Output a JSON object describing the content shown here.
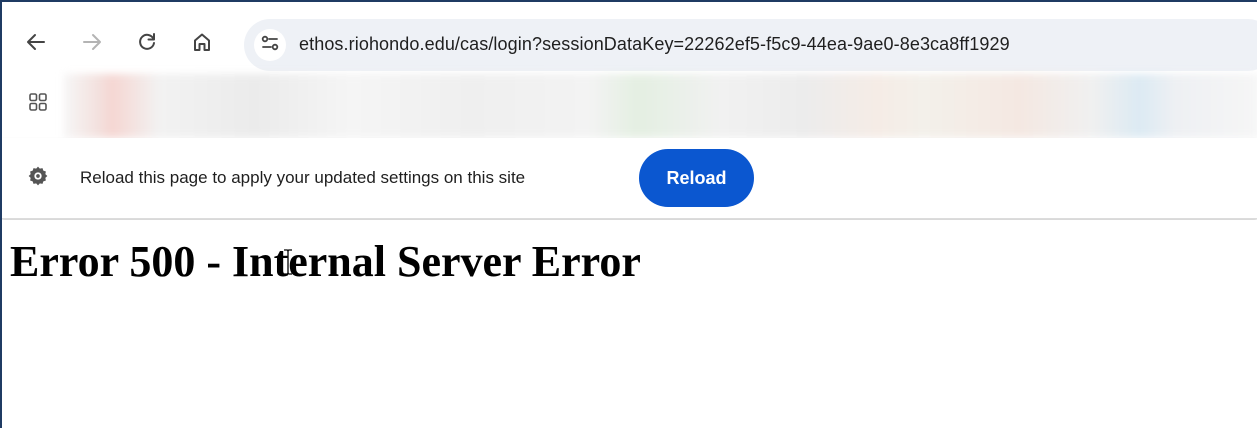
{
  "browser": {
    "url": "ethos.riohondo.edu/cas/login?sessionDataKey=22262ef5-f5c9-44ea-9ae0-8e3ca8ff1929",
    "nav_icons": [
      "back-icon",
      "forward-icon",
      "reload-icon",
      "home-icon",
      "site-info-icon"
    ],
    "bookmarks_icon": "apps-grid-icon"
  },
  "infobar": {
    "icon": "gear-icon",
    "message": "Reload this page to apply your updated settings on this site",
    "reload_label": "Reload",
    "button_color": "#0b57d0"
  },
  "page": {
    "heading": "Error 500 - Internal Server Error"
  }
}
